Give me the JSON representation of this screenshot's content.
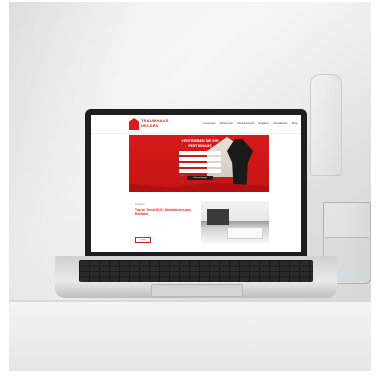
{
  "photo": {
    "scene": "",
    "colors": {
      "wall": "#ececec",
      "table": "#f0f0f0",
      "laptop_bezel": "#1e1e1e",
      "brand_red": "#d81e1e"
    }
  },
  "website": {
    "logo": {
      "line1": "TRAUMHAUS",
      "line2": "HELDEN"
    },
    "nav": [
      "Leistungen",
      "Referenzen",
      "Wohnkonzepte",
      "Ratgeber",
      "Kontaktieren",
      "Shop"
    ],
    "hero": {
      "title_line1": "VERTRIEBEN SIE IHR",
      "title_line2": "FERTIGHAUS",
      "field_placeholders": [
        "Name",
        "Telefon",
        "E-Mail",
        "Ort"
      ],
      "button": "Jetzt anfragen"
    },
    "article": {
      "kicker": "Ratgeber",
      "title": "Top im Trend 2021: Wohnküchen aus Edelholz",
      "body": "",
      "button": "Lesen"
    }
  },
  "icons": [
    "search-icon",
    "cart-icon",
    "menu-icon"
  ]
}
